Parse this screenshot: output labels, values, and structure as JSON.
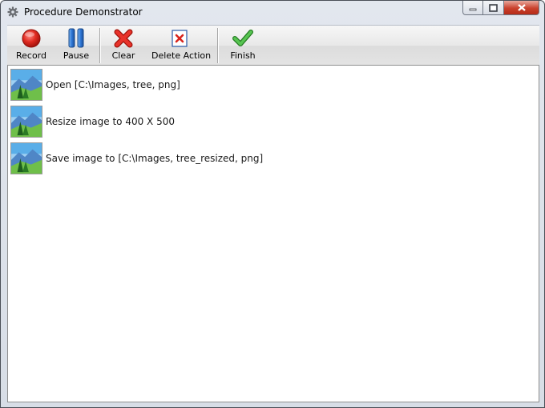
{
  "window": {
    "title": "Procedure Demonstrator"
  },
  "toolbar": {
    "record_label": "Record",
    "pause_label": "Pause",
    "clear_label": "Clear",
    "delete_label": "Delete Action",
    "finish_label": "Finish"
  },
  "actions": [
    {
      "label": "Open [C:\\Images, tree, png]",
      "icon": "landscape-image-icon"
    },
    {
      "label": "Resize image to 400 X 500",
      "icon": "landscape-image-icon"
    },
    {
      "label": "Save image to [C:\\Images, tree_resized, png]",
      "icon": "landscape-image-icon"
    }
  ],
  "colors": {
    "record": "#d8231c",
    "pause": "#2f78d6",
    "clear": "#d8231c",
    "finish": "#3aa535"
  }
}
